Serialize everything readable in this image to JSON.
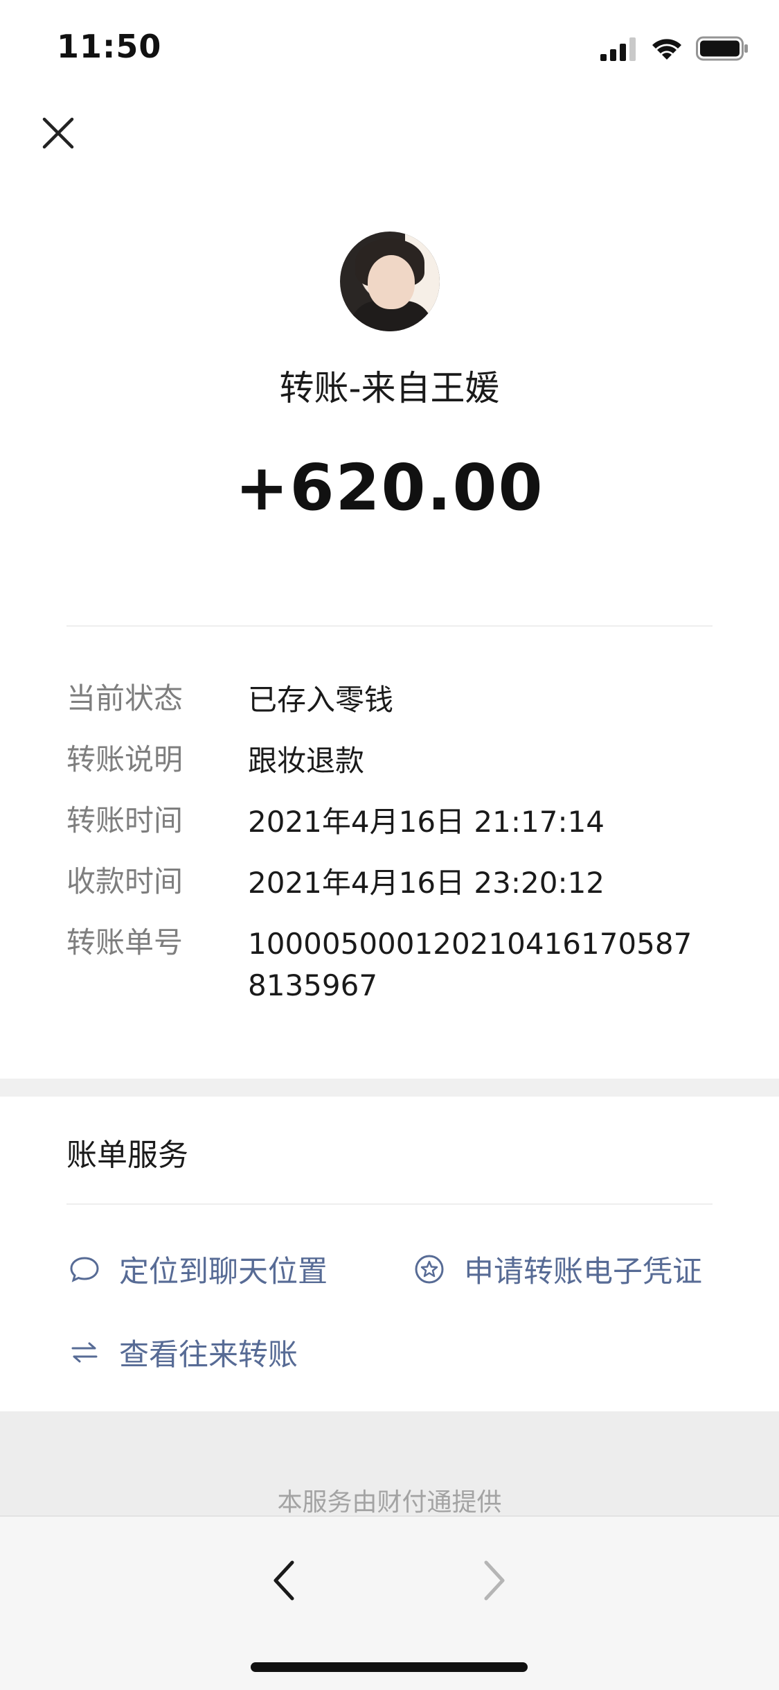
{
  "status_bar": {
    "time": "11:50"
  },
  "header": {
    "title": "转账-来自王媛",
    "amount": "+620.00"
  },
  "details": [
    {
      "label": "当前状态",
      "value": "已存入零钱"
    },
    {
      "label": "转账说明",
      "value": "跟妆退款"
    },
    {
      "label": "转账时间",
      "value": "2021年4月16日 21:17:14"
    },
    {
      "label": "收款时间",
      "value": "2021年4月16日 23:20:12"
    },
    {
      "label": "转账单号",
      "value": "10000500012021041617058781​35967"
    }
  ],
  "services": {
    "title": "账单服务",
    "locate_chat": "定位到聊天位置",
    "apply_receipt": "申请转账电子凭证",
    "view_transfers": "查看往来转账"
  },
  "footer": {
    "text": "本服务由财付通提供"
  },
  "colors": {
    "link": "#576b95",
    "muted": "#7e7e7e"
  }
}
